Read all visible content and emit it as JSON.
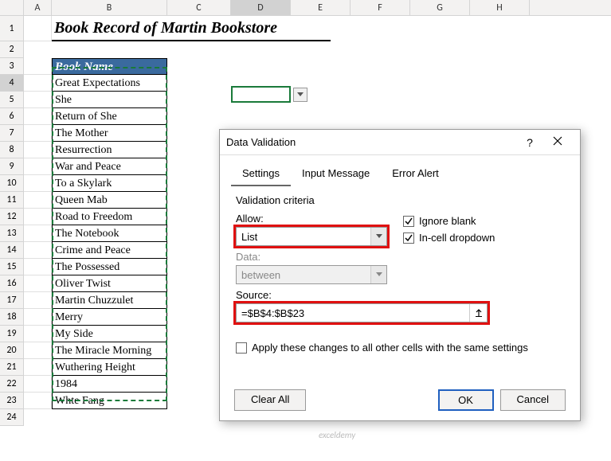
{
  "columns": [
    "A",
    "B",
    "C",
    "D",
    "E",
    "F",
    "G",
    "H"
  ],
  "rows": [
    "1",
    "2",
    "3",
    "4",
    "5",
    "6",
    "7",
    "8",
    "9",
    "10",
    "11",
    "12",
    "13",
    "14",
    "15",
    "16",
    "17",
    "18",
    "19",
    "20",
    "21",
    "22",
    "23",
    "24"
  ],
  "title": "Book Record of Martin Bookstore",
  "table_header": "Book Name",
  "books": [
    "Great Expectations",
    "She",
    "Return of She",
    "The Mother",
    "Resurrection",
    "War and Peace",
    "To a Skylark",
    "Queen Mab",
    "Road to Freedom",
    "The Notebook",
    "Crime and Peace",
    "The Possessed",
    "Oliver Twist",
    "Martin Chuzzulet",
    "Merry",
    "My Side",
    "The Miracle Morning",
    "Wuthering Height",
    "1984",
    "Whte Fang"
  ],
  "dialog": {
    "title": "Data Validation",
    "tabs": [
      "Settings",
      "Input Message",
      "Error Alert"
    ],
    "criteria_label": "Validation criteria",
    "allow_label": "Allow:",
    "allow_value": "List",
    "ignore_blank": "Ignore blank",
    "incell_dropdown": "In-cell dropdown",
    "data_label": "Data:",
    "data_value": "between",
    "source_label": "Source:",
    "source_value": "=$B$4:$B$23",
    "apply_changes": "Apply these changes to all other cells with the same settings",
    "clear_all": "Clear All",
    "ok": "OK",
    "cancel": "Cancel",
    "help": "?"
  },
  "watermark": "exceldemy"
}
